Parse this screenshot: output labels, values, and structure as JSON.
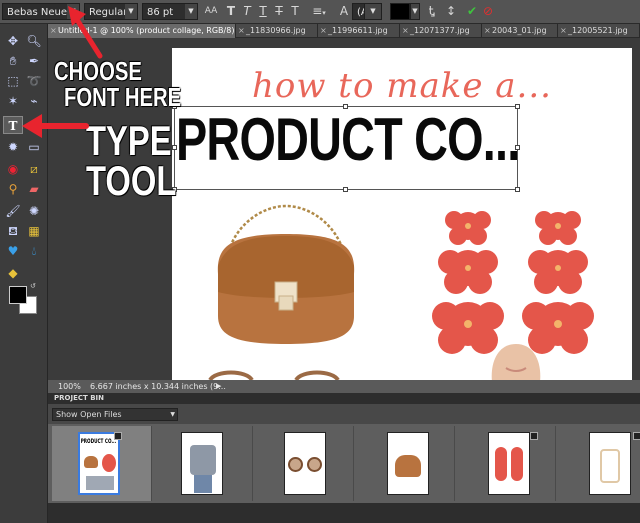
{
  "options_bar": {
    "font_family": "Bebas Neue",
    "font_style": "Regular",
    "font_size": "86 pt",
    "leading": "(Auto)",
    "text_color": "#000000",
    "format_glyphs": [
      "T",
      "T",
      "T",
      "T",
      "T"
    ]
  },
  "tabs": [
    {
      "label": "Untitled-1 @ 100% (product collage, RGB/8) *",
      "active": true
    },
    {
      "label": "_11830966.jpg"
    },
    {
      "label": "_11996611.jpg"
    },
    {
      "label": "_12071377.jpg"
    },
    {
      "label": "20043_01.jpg"
    },
    {
      "label": "_12005521.jpg"
    }
  ],
  "document": {
    "script_title": "how to make a...",
    "main_title": "PRODUCT CO..."
  },
  "annotations": {
    "choose_font": [
      "CHOOSE",
      "FONT HERE"
    ],
    "type_tool": [
      "TYPE",
      "TOOL"
    ],
    "arrow_color": "#e8242e"
  },
  "status_bar": {
    "zoom": "100%",
    "dimensions": "6.667 inches x 10.344 inches (9..."
  },
  "project_bin": {
    "header": "PROJECT BIN",
    "show_option": "Show Open Files",
    "thumbnails": [
      "collage",
      "tshirt",
      "sunglasses",
      "bag",
      "earrings",
      "shoe"
    ]
  },
  "colors": {
    "accent_red": "#e8242e",
    "script_coral": "#e8675a",
    "bag_brown": "#b8733f",
    "flower_coral": "#e4564a"
  }
}
